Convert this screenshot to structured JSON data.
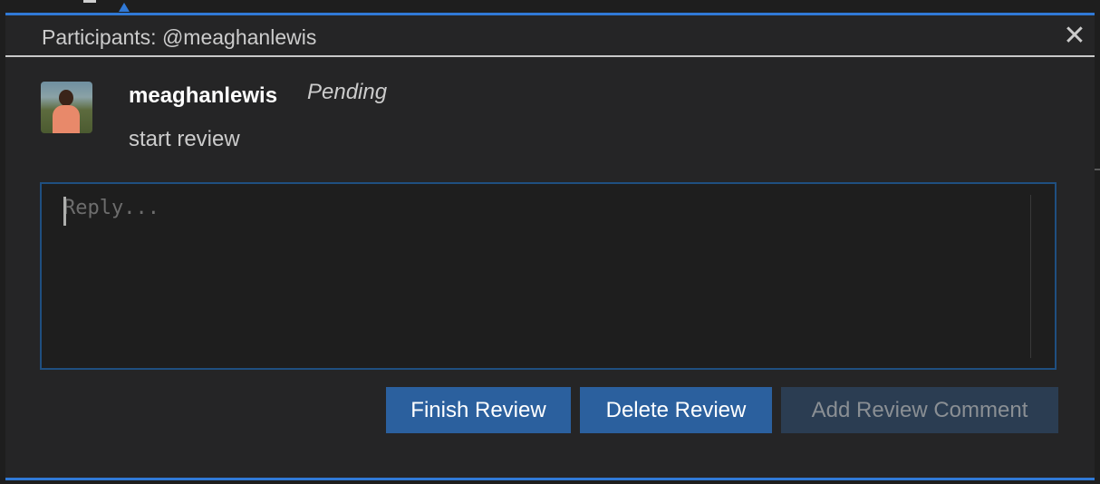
{
  "header": {
    "title": "Participants: @meaghanlewis",
    "close_glyph": "✕",
    "close_icon": "close-icon"
  },
  "comment": {
    "author": "meaghanlewis",
    "status": "Pending",
    "body": "start review",
    "avatar_icon": "user-avatar"
  },
  "reply": {
    "placeholder": "Reply...",
    "value": ""
  },
  "actions": {
    "finish_label": "Finish Review",
    "delete_label": "Delete Review",
    "add_label": "Add Review Comment"
  },
  "colors": {
    "accent": "#3079d6",
    "primary_button": "#2b609e",
    "disabled_button": "#2b3d52",
    "panel_background": "#252526",
    "input_background": "#1e1e1e"
  }
}
